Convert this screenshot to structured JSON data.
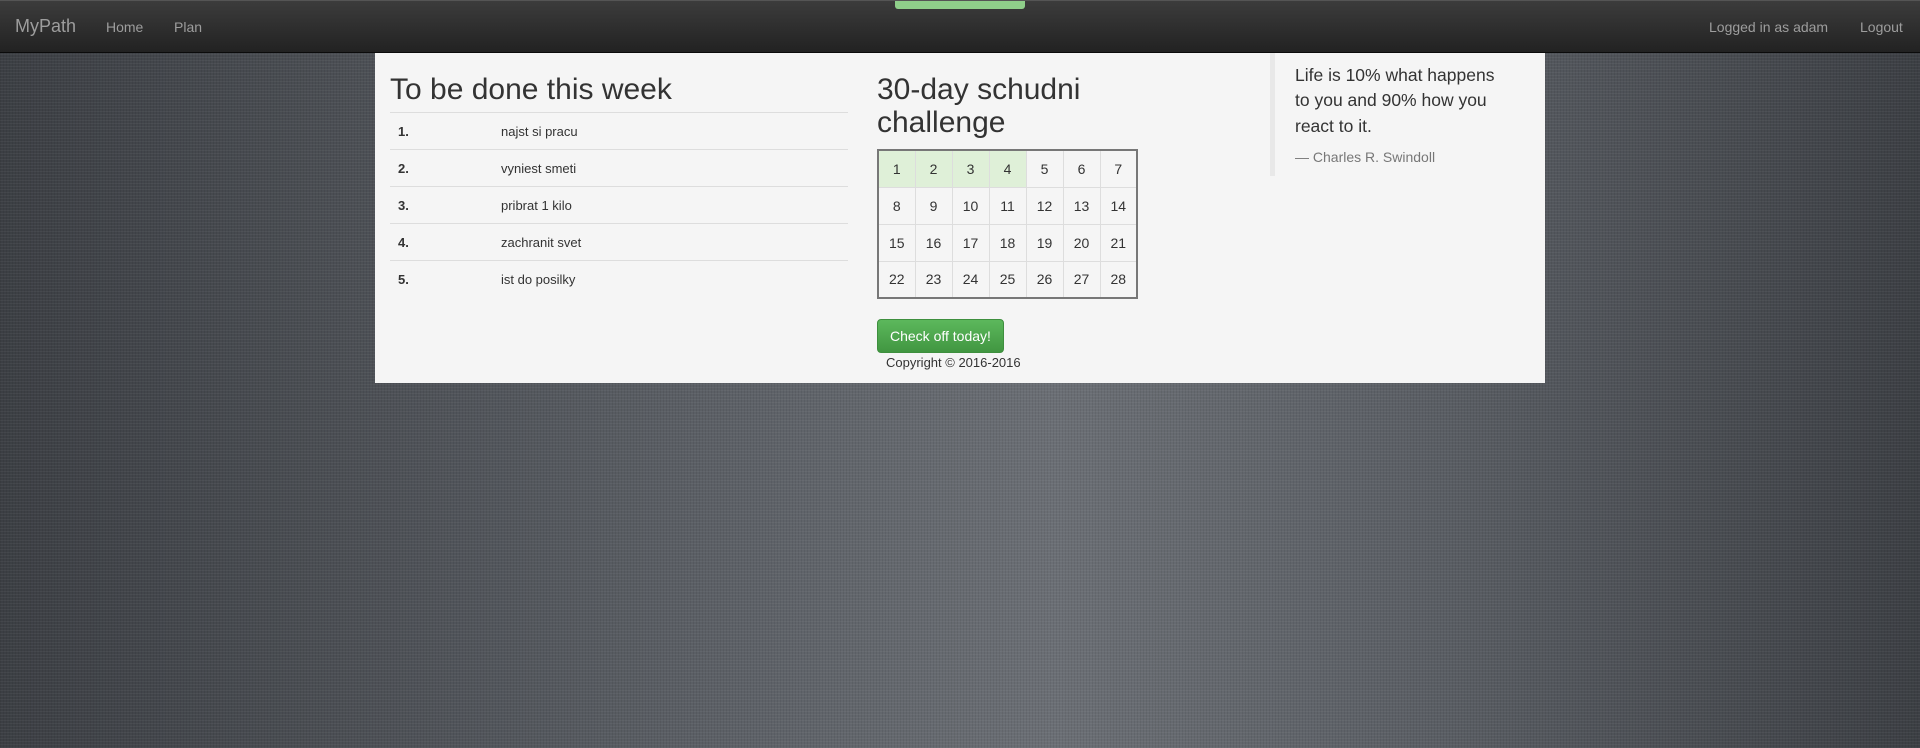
{
  "navbar": {
    "brand": "MyPath",
    "links": [
      "Home",
      "Plan"
    ],
    "logged_in": "Logged in as adam",
    "logout": "Logout"
  },
  "todo": {
    "title": "To be done this week",
    "items": [
      {
        "num": "1.",
        "text": "najst si pracu"
      },
      {
        "num": "2.",
        "text": "vyniest smeti"
      },
      {
        "num": "3.",
        "text": "pribrat 1 kilo"
      },
      {
        "num": "4.",
        "text": "zachranit svet"
      },
      {
        "num": "5.",
        "text": "ist do posilky"
      }
    ]
  },
  "challenge": {
    "title": "30-day schudni challenge",
    "done_days": 4,
    "weeks": [
      [
        "1",
        "2",
        "3",
        "4",
        "5",
        "6",
        "7"
      ],
      [
        "8",
        "9",
        "10",
        "11",
        "12",
        "13",
        "14"
      ],
      [
        "15",
        "16",
        "17",
        "18",
        "19",
        "20",
        "21"
      ],
      [
        "22",
        "23",
        "24",
        "25",
        "26",
        "27",
        "28"
      ]
    ],
    "done_color": "#dff0d8",
    "button": "Check off today!",
    "copyright": "Copyright © 2016-2016"
  },
  "quote": {
    "text": "Life is 10% what happens to you and 90% how you react to it.",
    "author": "— Charles R. Swindoll"
  }
}
